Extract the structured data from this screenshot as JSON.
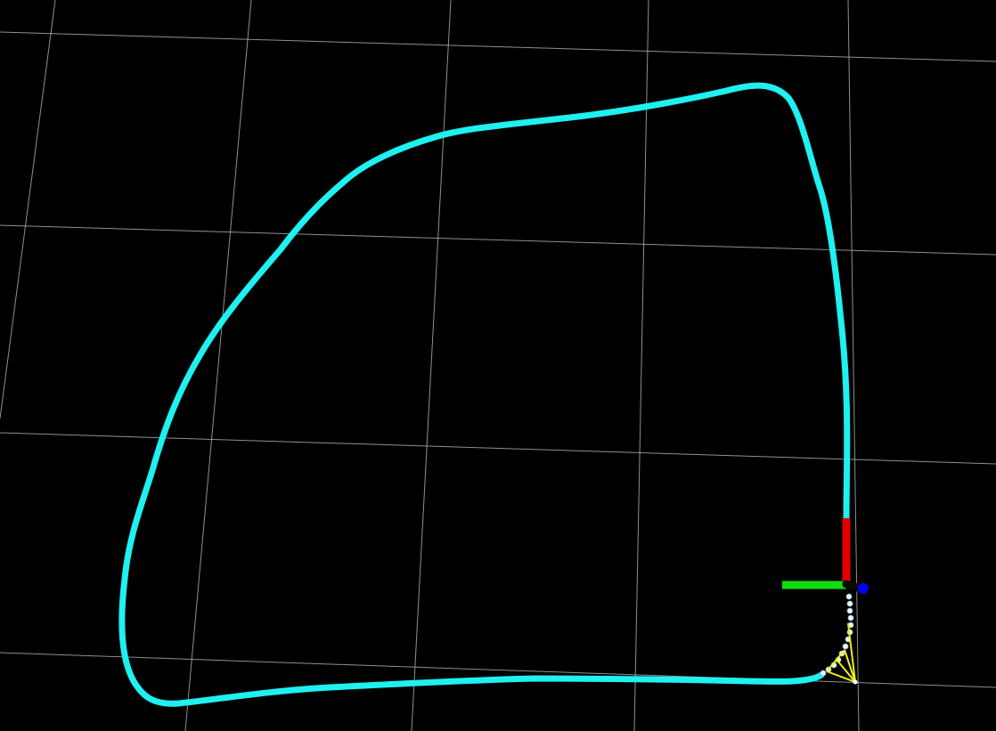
{
  "scene": {
    "background_color": "#000000",
    "grid_color": "#a9a9a9",
    "trajectory_color": "#1ff0f0",
    "axis_colors": {
      "x_axis": "#e00000",
      "y_axis": "#11dd11",
      "z_axis": "#0000ff"
    },
    "constraint_color": "#f0ef14"
  }
}
